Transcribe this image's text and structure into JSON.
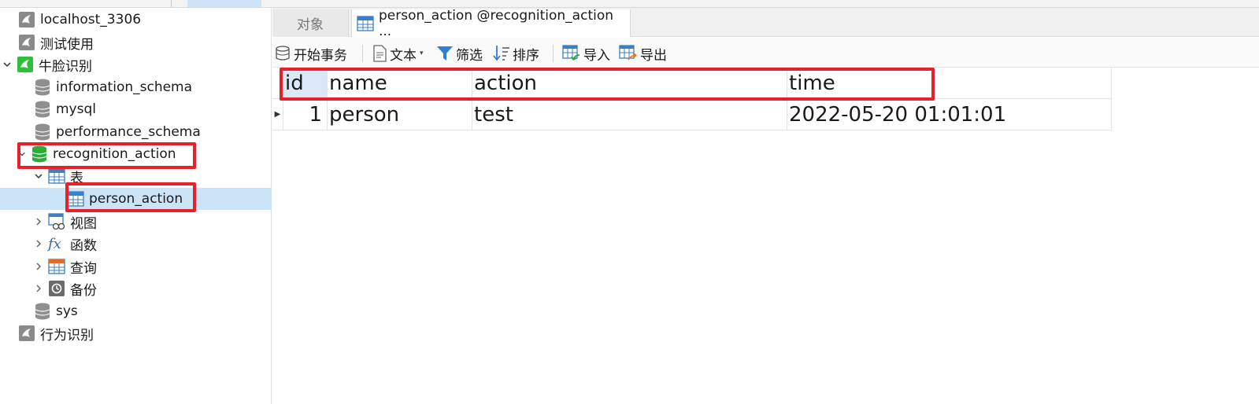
{
  "sidebar": {
    "connections": [
      {
        "label": "localhost_3306"
      },
      {
        "label": "测试使用"
      },
      {
        "label": "牛脸识别"
      }
    ],
    "databases": [
      {
        "label": "information_schema"
      },
      {
        "label": "mysql"
      },
      {
        "label": "performance_schema"
      },
      {
        "label": "recognition_action"
      }
    ],
    "groups": {
      "tables": "表",
      "table_item": "person_action",
      "views": "视图",
      "functions": "函数",
      "queries": "查询",
      "backups": "备份"
    },
    "sys_db": "sys",
    "last_connection": "行为识别"
  },
  "tabs": {
    "objects": "对象",
    "active": "person_action @recognition_action ..."
  },
  "toolbar": {
    "begin_transaction": "开始事务",
    "text": "文本",
    "filter": "筛选",
    "sort": "排序",
    "import": "导入",
    "export": "导出"
  },
  "table": {
    "columns": [
      "id",
      "name",
      "action",
      "time"
    ],
    "rows": [
      [
        "1",
        "person",
        "test",
        "2022-05-20 01:01:01"
      ]
    ]
  },
  "colors": {
    "highlight": "#e8202a",
    "selection": "#cce4f7",
    "connection_green": "#2fbf3a"
  }
}
